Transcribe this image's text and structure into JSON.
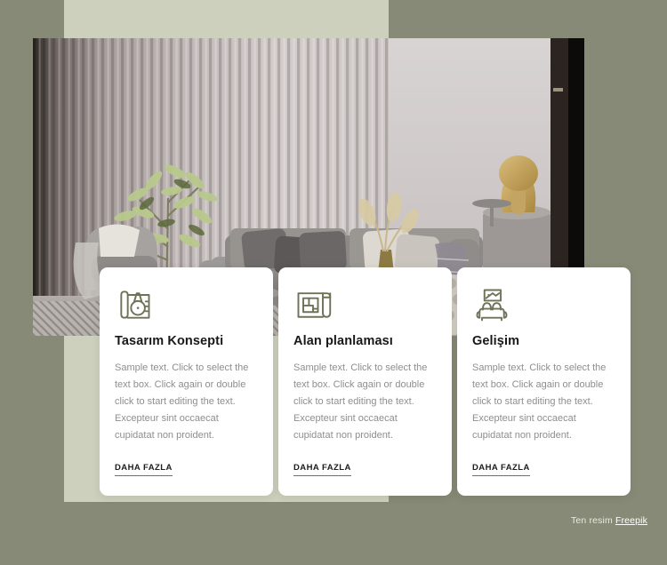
{
  "theme": {
    "outer_background": "#868a76",
    "panel_background": "#ccd0bc",
    "card_background": "#ffffff",
    "icon_color": "#6e7257",
    "title_color": "#17181a",
    "body_color": "#8e8e8e",
    "link_underline_color": "#6e7257"
  },
  "hero": {
    "alt": "Modern living room with fluted wall panels, olive tree, grey sectional sofa, gold table lamp and knitted pouf"
  },
  "cards": [
    {
      "icon_name": "blueprint-compass-icon",
      "title": "Tasarım Konsepti",
      "body": "Sample text. Click to select the text box. Click again or double click to start editing the text. Excepteur sint occaecat cupidatat non proident.",
      "link_label": "DAHA FAZLA"
    },
    {
      "icon_name": "floor-plan-icon",
      "title": "Alan planlaması",
      "body": "Sample text. Click to select the text box. Click again or double click to start editing the text. Excepteur sint occaecat cupidatat non proident.",
      "link_label": "DAHA FAZLA"
    },
    {
      "icon_name": "sofa-picture-icon",
      "title": "Gelişim",
      "body": "Sample text. Click to select the text box. Click again or double click to start editing the text. Excepteur sint occaecat cupidatat non proident.",
      "link_label": "DAHA FAZLA"
    }
  ],
  "credit": {
    "prefix": "Ten resim ",
    "link_label": "Freepik"
  }
}
